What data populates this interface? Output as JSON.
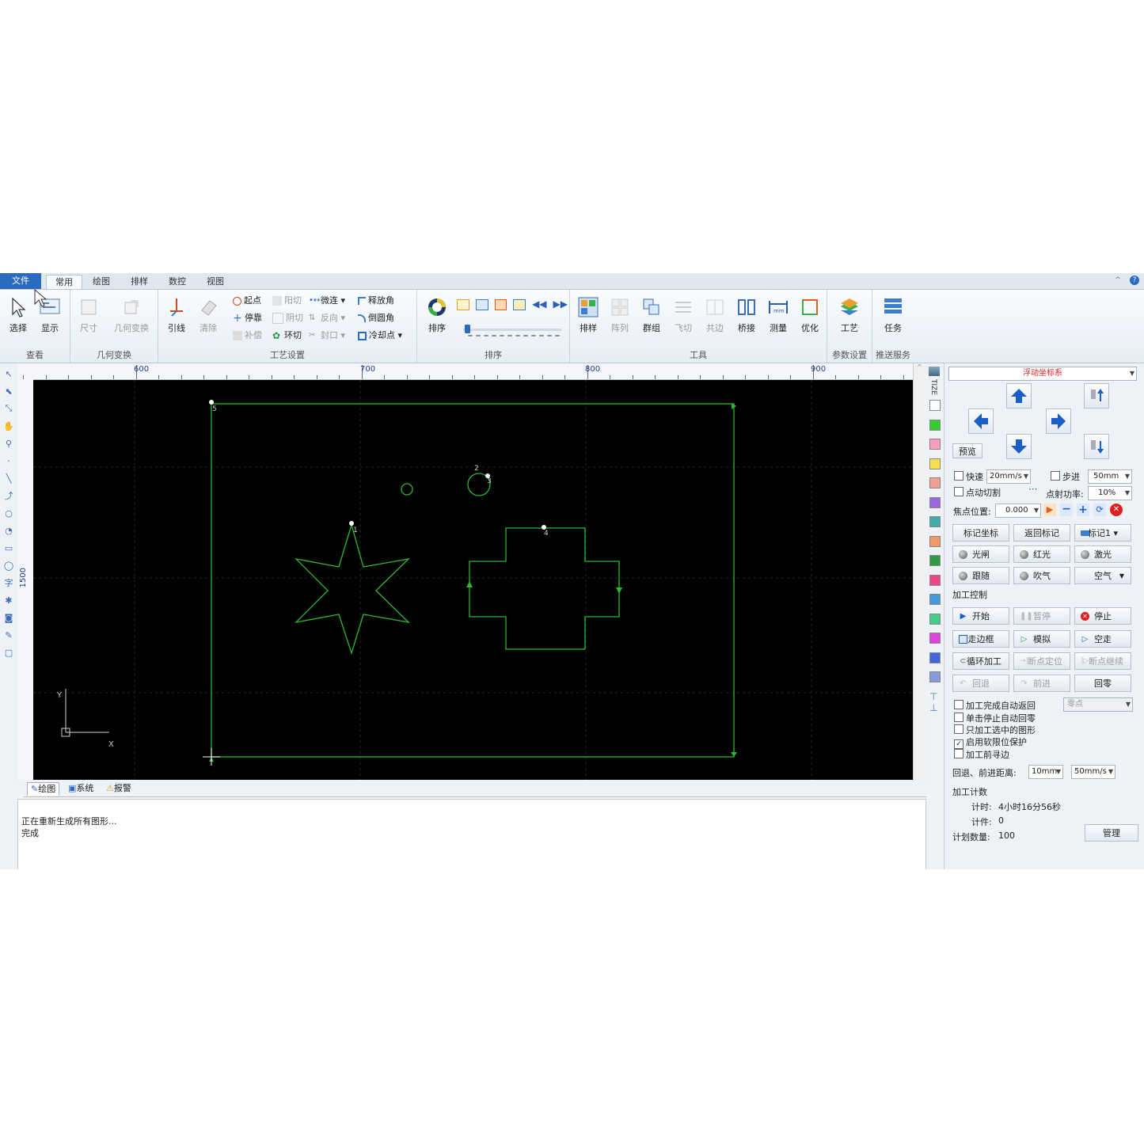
{
  "menu": {
    "tabs": [
      "文件",
      "常用",
      "绘图",
      "排样",
      "数控",
      "视图"
    ],
    "active_tab": "常用"
  },
  "ribbon": {
    "view_group": {
      "label": "查看",
      "select": "选择",
      "display": "显示"
    },
    "transform_group": {
      "label": "几何变换",
      "size": "尺寸",
      "transform": "几何变换"
    },
    "process_group": {
      "label": "工艺设置",
      "lead": "引线",
      "clear": "清除",
      "start_point": "起点",
      "stop_point": "停靠",
      "compensate": "补偿",
      "positive_cut": "阳切",
      "negative_cut": "阴切",
      "ring_cut": "环切",
      "micro_joint": "微连",
      "reverse": "反向",
      "seal": "封口",
      "release_corner": "释放角",
      "round_corner": "倒圆角",
      "cooling_point": "冷却点"
    },
    "sort_group": {
      "label": "排序",
      "sort": "排序"
    },
    "tools_group": {
      "label": "工具",
      "nest": "排样",
      "array": "阵列",
      "group": "群组",
      "fly_cut": "飞切",
      "common_edge": "共边",
      "bridge": "桥接",
      "measure": "测量",
      "optimize": "优化"
    },
    "params_group": {
      "label": "参数设置",
      "process": "工艺"
    },
    "push_group": {
      "label": "推送服务",
      "task": "任务"
    }
  },
  "ruler": {
    "labels": [
      "600",
      "700",
      "800",
      "900"
    ],
    "vlabel": "1500"
  },
  "canvas": {
    "markers": [
      "1",
      "2",
      "3",
      "4",
      "5"
    ],
    "axis_x": "X",
    "axis_y": "Y",
    "line_color": "#2fb82f"
  },
  "bottom_tabs": [
    "绘图",
    "系统",
    "报警"
  ],
  "log": [
    "正在重新生成所有图形...",
    "完成"
  ],
  "palette": [
    "#ffffff",
    "#33cc33",
    "#f5a0b8",
    "#f5e050",
    "#f0a090",
    "#9966dd",
    "#44aaaa",
    "#ee9966",
    "#339944",
    "#ee4488",
    "#4499dd",
    "#44cc88",
    "#dd44dd",
    "#4466dd",
    "#8899dd"
  ],
  "right_panel": {
    "coord_system": "浮动坐标系",
    "preview": "预览",
    "fast": "快速",
    "fast_speed": "20mm/s",
    "step": "步进",
    "step_size": "50mm",
    "spot_cut": "点动切割",
    "spot_power_label": "点射功率:",
    "spot_power": "10%",
    "focus_label": "焦点位置:",
    "focus_value": "0.000",
    "mark_coord": "标记坐标",
    "return_mark": "返回标记",
    "mark1": "标记1",
    "shutter": "光闸",
    "red_light": "红光",
    "laser": "激光",
    "follow": "跟随",
    "blow": "吹气",
    "air": "空气",
    "process_control": "加工控制",
    "start": "开始",
    "pause": "暂停",
    "stop": "停止",
    "frame": "走边框",
    "simulate": "模拟",
    "dry_run": "空走",
    "loop": "循环加工",
    "breakpoint_locate": "断点定位",
    "breakpoint_continue": "断点继续",
    "back": "回退",
    "forward": "前进",
    "return_zero": "回零",
    "zero_point": "零点",
    "checks": [
      {
        "label": "加工完成自动返回",
        "checked": false
      },
      {
        "label": "单击停止自动回零",
        "checked": false
      },
      {
        "label": "只加工选中的图形",
        "checked": false
      },
      {
        "label": "启用软限位保护",
        "checked": true
      },
      {
        "label": "加工前寻边",
        "checked": false
      }
    ],
    "distance_label": "回退、前进距离:",
    "distance_value": "10mm",
    "distance_speed": "50mm/s",
    "count_title": "加工计数",
    "timer_label": "计时:",
    "timer_value": "4小时16分56秒",
    "count_label": "计件:",
    "count_value": "0",
    "plan_label": "计划数量:",
    "plan_value": "100",
    "manage": "管理"
  }
}
